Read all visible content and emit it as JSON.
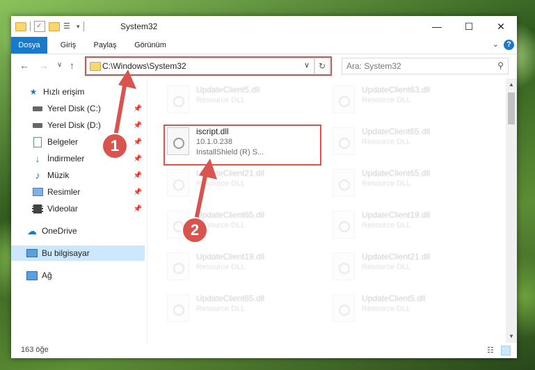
{
  "window": {
    "title": "System32",
    "controls": {
      "minimize": "—",
      "maximize": "☐",
      "close": "✕"
    }
  },
  "ribbon": {
    "tabs": [
      "Dosya",
      "Giriş",
      "Paylaş",
      "Görünüm"
    ],
    "help": "?"
  },
  "address": {
    "path": "C:\\Windows\\System32",
    "search_placeholder": "Ara: System32"
  },
  "sidebar": {
    "items": [
      {
        "label": "Hızlı erişim",
        "icon": "star-icon"
      },
      {
        "label": "Yerel Disk (C:)",
        "icon": "drive-icon"
      },
      {
        "label": "Yerel Disk (D:)",
        "icon": "drive-icon"
      },
      {
        "label": "Belgeler",
        "icon": "documents-icon"
      },
      {
        "label": "İndirmeler",
        "icon": "download-icon"
      },
      {
        "label": "Müzik",
        "icon": "music-icon"
      },
      {
        "label": "Resimler",
        "icon": "pictures-icon"
      },
      {
        "label": "Videolar",
        "icon": "video-icon"
      },
      {
        "label": "OneDrive",
        "icon": "cloud-icon"
      },
      {
        "label": "Bu bilgisayar",
        "icon": "computer-icon"
      },
      {
        "label": "Ağ",
        "icon": "network-icon"
      }
    ]
  },
  "files": {
    "highlighted": {
      "name": "iscript.dll",
      "version": "10.1.0.238",
      "description": "InstallShield (R) S..."
    },
    "left_column": [
      {
        "name": "UpdateClient5.dll",
        "type": "Resource DLL"
      },
      {
        "name": "UpdateClient21.dll",
        "type": "Resource DLL"
      },
      {
        "name": "UpdateClient65.dll",
        "type": "Resource DLL"
      },
      {
        "name": "UpdateClient19.dll",
        "type": "Resource DLL"
      },
      {
        "name": "UpdateClient65.dll",
        "type": "Resource DLL"
      }
    ],
    "right_column": [
      {
        "name": "UpdateClient63.dll",
        "type": "Resource DLL"
      },
      {
        "name": "UpdateClient65.dll",
        "type": "Resource DLL"
      },
      {
        "name": "UpdateClient65.dll",
        "type": "Resource DLL"
      },
      {
        "name": "UpdateClient19.dll",
        "type": "Resource DLL"
      },
      {
        "name": "UpdateClient21.dll",
        "type": "Resource DLL"
      },
      {
        "name": "UpdateClient5.dll",
        "type": "Resource DLL"
      }
    ]
  },
  "status": {
    "count": "163 öğe"
  },
  "callouts": [
    "1",
    "2"
  ],
  "colors": {
    "accent": "#1979ca",
    "highlight": "#d9534f",
    "selected": "#cce8ff"
  }
}
